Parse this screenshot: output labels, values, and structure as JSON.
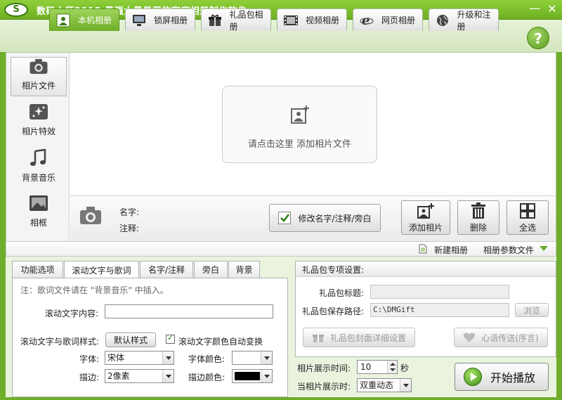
{
  "window": {
    "title": "数码大师2013    最强大最易用的家庭相册制作软件",
    "logo_text": "S",
    "minimize": "—",
    "close": "✕"
  },
  "tabs": [
    {
      "label": "本机相册",
      "active": true,
      "icon": "photo-frame-icon"
    },
    {
      "label": "锁屏相册",
      "active": false,
      "icon": "monitor-icon"
    },
    {
      "label": "礼品包相册",
      "active": false,
      "icon": "gift-icon"
    },
    {
      "label": "视频相册",
      "active": false,
      "icon": "film-icon"
    },
    {
      "label": "网页相册",
      "active": false,
      "icon": "ie-icon"
    },
    {
      "label": "升级和注册",
      "active": false,
      "icon": "globe-icon"
    }
  ],
  "help_label": "?",
  "left_nav": [
    {
      "label": "相片文件",
      "active": true,
      "icon": "camera-icon"
    },
    {
      "label": "相片特效",
      "active": false,
      "icon": "sparkle-icon"
    },
    {
      "label": "背景音乐",
      "active": false,
      "icon": "music-note-icon"
    },
    {
      "label": "相框",
      "active": false,
      "icon": "picture-frame-icon"
    }
  ],
  "dropzone": {
    "text": "请点击这里  添加相片文件"
  },
  "info": {
    "name_label": "名字:",
    "note_label": "注释:"
  },
  "buttons": {
    "modify": "修改名字/注释/旁白",
    "add_photo": "添加相片",
    "delete": "删除",
    "select_all": "全选"
  },
  "strip": {
    "new_album": "新建相册",
    "param_file": "相册参数文件"
  },
  "bottom_tabs": [
    {
      "label": "功能选项",
      "active": false
    },
    {
      "label": "滚动文字与歌词",
      "active": true
    },
    {
      "label": "名字/注释",
      "active": false
    },
    {
      "label": "旁白",
      "active": false
    },
    {
      "label": "背景",
      "active": false
    }
  ],
  "lyrics_panel": {
    "note": "注：歌词文件请在 \"背景音乐\" 中插入。",
    "content_label": "滚动文字内容:",
    "content_value": "",
    "style_label": "滚动文字与歌词样式:",
    "default_style_btn": "默认样式",
    "auto_color_label": "滚动文字颜色自动变换",
    "auto_color_checked": true,
    "font_label": "字体:",
    "font_value": "宋体",
    "font_color_label": "字体颜色:",
    "font_color_value": "#ffffff",
    "stroke_label": "描边:",
    "stroke_value": "2像素",
    "stroke_color_label": "描边颜色:",
    "stroke_color_value": "#000000"
  },
  "gift_panel": {
    "title": "礼品包专项设置:",
    "gift_title_label": "礼品包标题:",
    "gift_title_value": "",
    "save_path_label": "礼品包保存路径:",
    "save_path_value": "C:\\DMGift",
    "browse_btn": "浏览",
    "cover_btn": "礼品包封面详细设置",
    "heart_btn": "心语传送(序言)"
  },
  "playback": {
    "show_time_label": "相片展示时间:",
    "show_time_value": "10",
    "sec_label": "秒",
    "when_label": "当相片展示时:",
    "when_value": "双重动态",
    "start_btn": "开始播放"
  },
  "colors": {
    "brand_green": "#6db021",
    "accent_green": "#6aaa2a"
  }
}
